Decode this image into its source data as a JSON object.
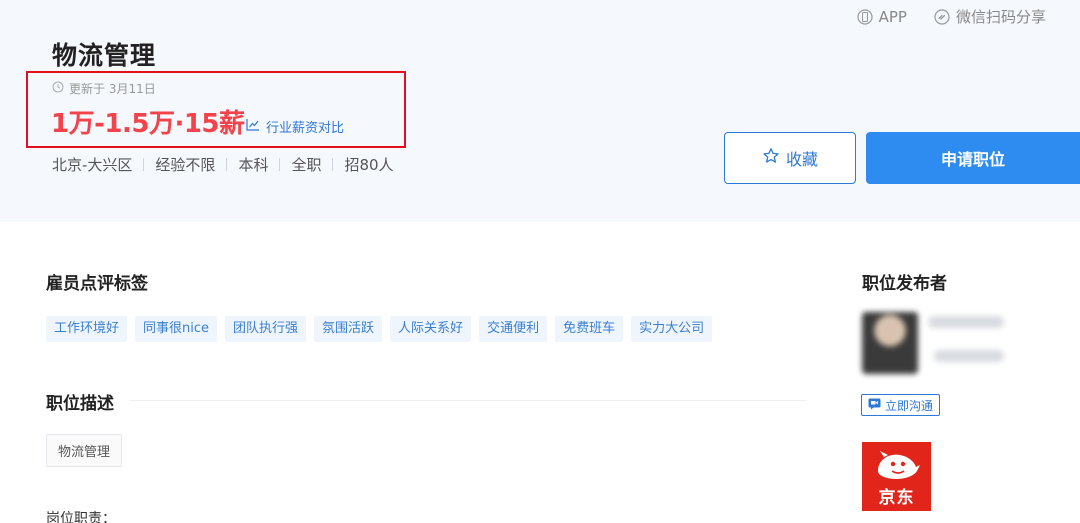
{
  "top_links": {
    "app": "APP",
    "share": "微信扫码分享"
  },
  "job": {
    "title": "物流管理",
    "updated": "更新于 3月11日",
    "salary": "1万-1.5万·15薪",
    "compare": "行业薪资对比",
    "meta": [
      "北京-大兴区",
      "经验不限",
      "本科",
      "全职",
      "招80人"
    ]
  },
  "actions": {
    "favorite": "收藏",
    "apply": "申请职位"
  },
  "sections": {
    "employee_tags_title": "雇员点评标签",
    "employee_tags": [
      "工作环境好",
      "同事很nice",
      "团队执行强",
      "氛围活跃",
      "人际关系好",
      "交通便利",
      "免费班车",
      "实力大公司"
    ],
    "description_title": "职位描述",
    "description_tag": "物流管理",
    "duty_title": "岗位职责："
  },
  "publisher": {
    "title": "职位发布者",
    "chat": "立即沟通",
    "company_logo_text": "京东"
  },
  "colors": {
    "accent": "#2e8cf0",
    "salary": "#f2434b",
    "highlight_border": "#e0101e",
    "brand_red": "#e1251b"
  }
}
